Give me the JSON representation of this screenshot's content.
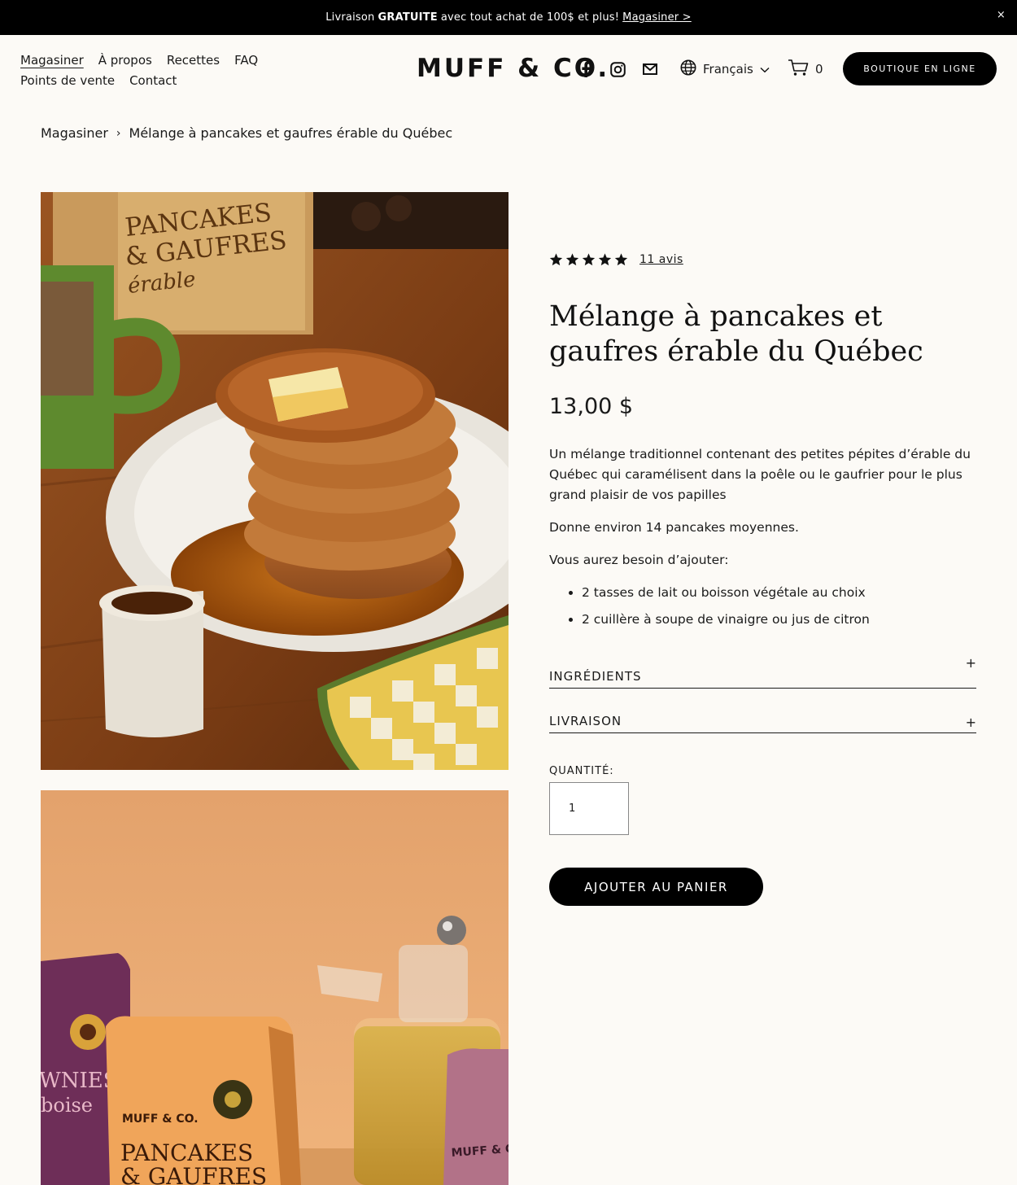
{
  "announcement": {
    "prefix": "Livraison",
    "bold": "GRATUITE",
    "suffix": "avec tout achat de 100$ et plus!",
    "link": "Magasiner >",
    "close": "×"
  },
  "nav": {
    "row1": [
      "Magasiner",
      "À propos",
      "Recettes",
      "FAQ"
    ],
    "row2": [
      "Points de vente",
      "Contact"
    ]
  },
  "logo": "MUFF & CO.",
  "header": {
    "language": "Français",
    "cart_count": "0",
    "shop_button": "BOUTIQUE EN LIGNE",
    "icons": [
      "facebook-icon",
      "instagram-icon",
      "email-icon",
      "globe-icon",
      "cart-icon"
    ]
  },
  "breadcrumb": {
    "parent": "Magasiner",
    "separator": "›",
    "current": "Mélange à pancakes et gaufres érable du Québec"
  },
  "images": {
    "photo1": {
      "package_line1": "PANCAKES",
      "package_line2": "& GAUFRES",
      "package_line3": "érable"
    },
    "photo2": {
      "brand": "MUFF & CO.",
      "package_line1": "PANCAKES",
      "package_line2": "& GAUFRES",
      "left_bag_line1": "WNIES",
      "left_bag_line2": "boise",
      "right_bag_brand": "MUFF & C"
    }
  },
  "product": {
    "rating": 5,
    "reviews": "11 avis",
    "title": "Mélange à pancakes et gaufres érable du Québec",
    "price": "13,00 $",
    "description": "Un mélange traditionnel contenant des petites pépites d’érable du Québec qui caramélisent dans la poêle ou le gaufrier pour le plus grand plaisir de vos papilles",
    "yield": "Donne environ 14 pancakes moyennes.",
    "needs_label": "Vous aurez besoin d’ajouter:",
    "needs": [
      "2 tasses de lait ou boisson végétale au choix",
      "2 cuillère à soupe de vinaigre ou jus de citron"
    ],
    "accordions": [
      {
        "label": "INGRÉDIENTS",
        "icon": "+"
      },
      {
        "label": "LIVRAISON",
        "icon": "+"
      }
    ],
    "quantity_label": "QUANTITÉ:",
    "quantity_value": "1",
    "add_to_cart": "AJOUTER AU PANIER"
  }
}
